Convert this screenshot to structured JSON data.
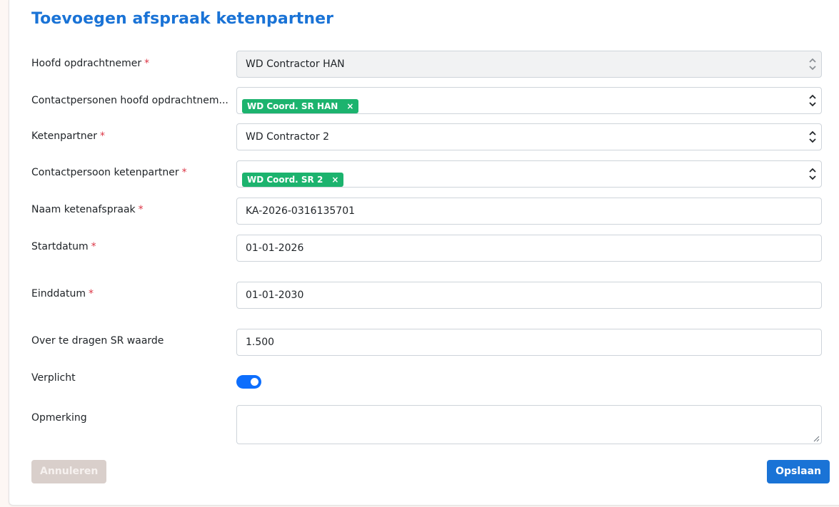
{
  "page": {
    "title": "Toevoegen afspraak ketenpartner"
  },
  "colors": {
    "accent": "#1a73d6",
    "tag": "#1cb36e",
    "required": "#dc3545",
    "toggle_on": "#0d6efd"
  },
  "form": {
    "hoofd_opdrachtnemer": {
      "label": "Hoofd opdrachtnemer",
      "required": "*",
      "value": "WD Contractor HAN"
    },
    "contactpersonen_hoofd": {
      "label": "Contactpersonen hoofd opdrachtnem...",
      "tag": "WD Coord. SR HAN",
      "tag_remove": "×"
    },
    "ketenpartner": {
      "label": "Ketenpartner",
      "required": "*",
      "value": "WD Contractor 2"
    },
    "contactpersoon_ketenpartner": {
      "label": "Contactpersoon ketenpartner",
      "required": "*",
      "tag": "WD Coord. SR 2",
      "tag_remove": "×"
    },
    "naam_ketenafspraak": {
      "label": "Naam ketenafspraak",
      "required": "*",
      "value": "KA-2026-0316135701"
    },
    "startdatum": {
      "label": "Startdatum",
      "required": "*",
      "value": "01-01-2026"
    },
    "einddatum": {
      "label": "Einddatum",
      "required": "*",
      "value": "01-01-2030"
    },
    "sr_waarde": {
      "label": "Over te dragen SR waarde",
      "value": "1.500"
    },
    "verplicht": {
      "label": "Verplicht",
      "checked": true
    },
    "opmerking": {
      "label": "Opmerking",
      "value": ""
    }
  },
  "buttons": {
    "cancel": "Annuleren",
    "save": "Opslaan"
  },
  "icons": {
    "select": "chevron-up-down-icon",
    "resize": "resize-grip-icon"
  }
}
